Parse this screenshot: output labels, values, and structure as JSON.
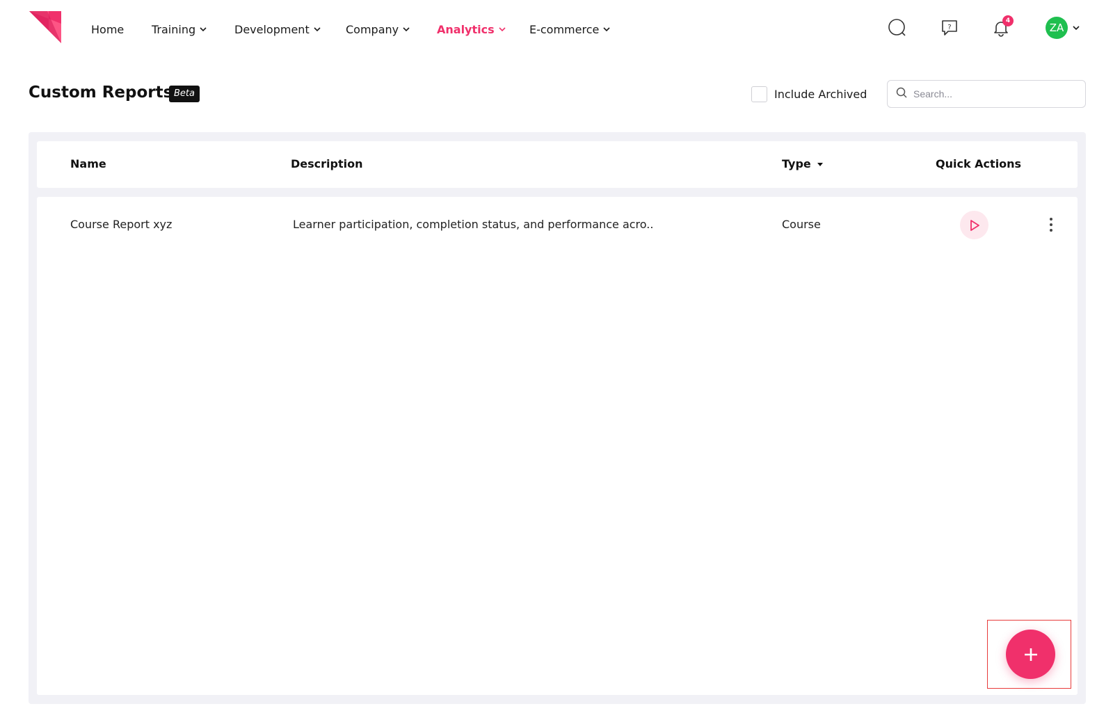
{
  "colors": {
    "accent": "#f0306b",
    "avatar_bg": "#1fbf4f",
    "panel_bg": "#f1f1f6"
  },
  "nav": {
    "items": [
      {
        "label": "Home",
        "has_dropdown": false,
        "active": false
      },
      {
        "label": "Training",
        "has_dropdown": true,
        "active": false
      },
      {
        "label": "Development",
        "has_dropdown": true,
        "active": false
      },
      {
        "label": "Company",
        "has_dropdown": true,
        "active": false
      },
      {
        "label": "Analytics",
        "has_dropdown": true,
        "active": true
      },
      {
        "label": "E-commerce",
        "has_dropdown": true,
        "active": false
      }
    ],
    "icons": [
      "search-icon",
      "help-chat-icon",
      "bell-icon"
    ],
    "notification_count": "4",
    "avatar_initials": "ZA"
  },
  "page": {
    "title": "Custom Reports",
    "badge": "Beta",
    "include_archived_label": "Include Archived",
    "include_archived_checked": false,
    "search_placeholder": "Search...",
    "search_value": ""
  },
  "table": {
    "columns": [
      "Name",
      "Description",
      "Type",
      "Quick Actions"
    ],
    "rows": [
      {
        "name": "Course Report xyz",
        "description": "Learner participation, completion status, and performance acro..",
        "type": "Course"
      }
    ]
  },
  "fab": {
    "icon": "plus-icon"
  }
}
